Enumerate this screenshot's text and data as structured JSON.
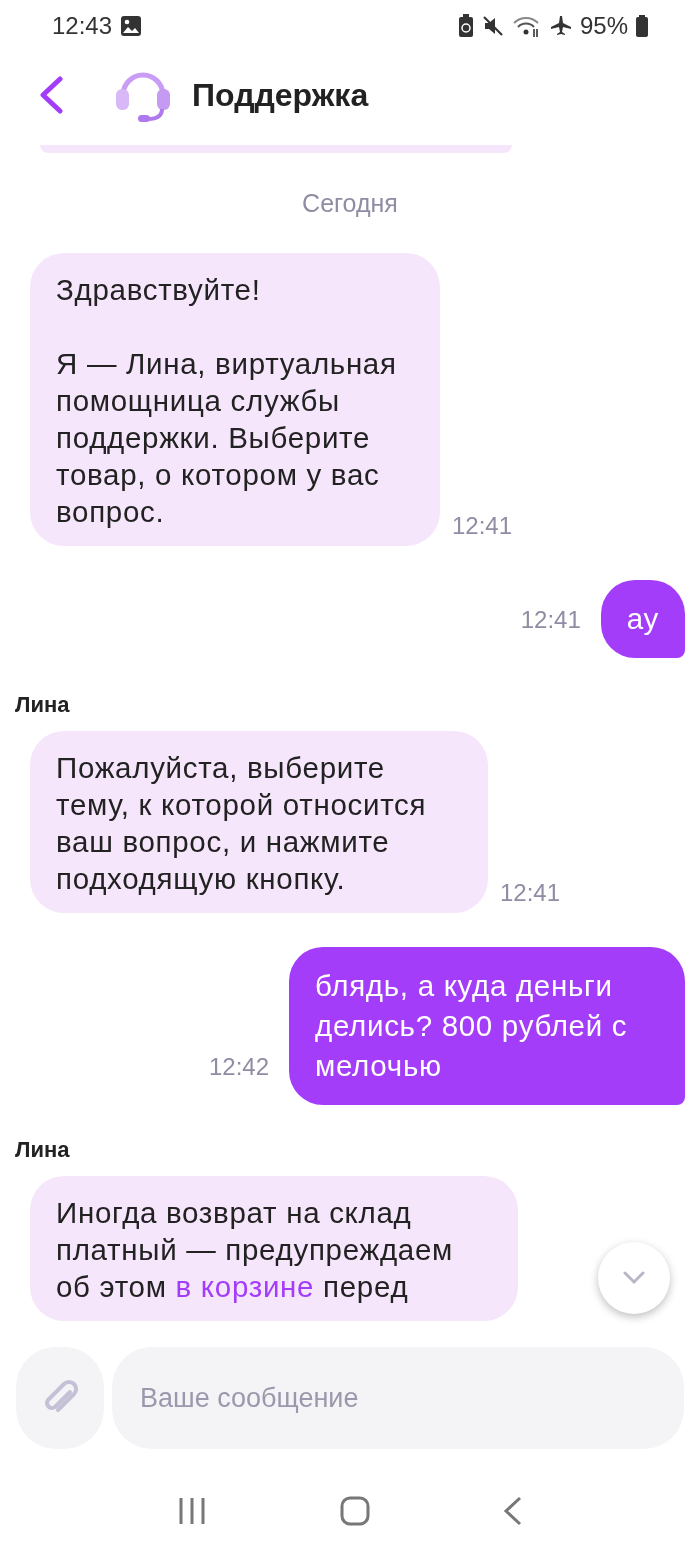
{
  "status_bar": {
    "time": "12:43",
    "battery": "95%"
  },
  "header": {
    "title": "Поддержка"
  },
  "date_divider": "Сегодня",
  "messages": [
    {
      "kind": "incoming",
      "paragraphs": [
        [
          {
            "kind": "text",
            "text": "Здравствуйте!"
          }
        ],
        [
          {
            "kind": "text",
            "text": "Я — Лина, виртуальная помощница службы поддержки. Выберите товар, о котором у вас вопрос."
          }
        ]
      ],
      "time": "12:41"
    },
    {
      "kind": "outgoing",
      "paragraphs": [
        [
          {
            "kind": "text",
            "text": "ау"
          }
        ]
      ],
      "time": "12:41"
    },
    {
      "kind": "incoming",
      "sender": "Лина",
      "paragraphs": [
        [
          {
            "kind": "text",
            "text": "Пожалуйста, выберите тему, к которой относится ваш вопрос, и нажмите подходящую кнопку."
          }
        ]
      ],
      "time": "12:41"
    },
    {
      "kind": "outgoing",
      "paragraphs": [
        [
          {
            "kind": "text",
            "text": "блядь, а куда деньги делись? 800 рублей с мелочью"
          }
        ]
      ],
      "time": "12:42"
    },
    {
      "kind": "incoming",
      "sender": "Лина",
      "paragraphs": [
        [
          {
            "kind": "text",
            "text": "Иногда возврат на склад платный — предупреждаем об этом "
          },
          {
            "kind": "link",
            "text": "в корзине"
          },
          {
            "kind": "text",
            "text": " перед"
          }
        ]
      ]
    }
  ],
  "composer": {
    "placeholder": "Ваше сообщение"
  }
}
